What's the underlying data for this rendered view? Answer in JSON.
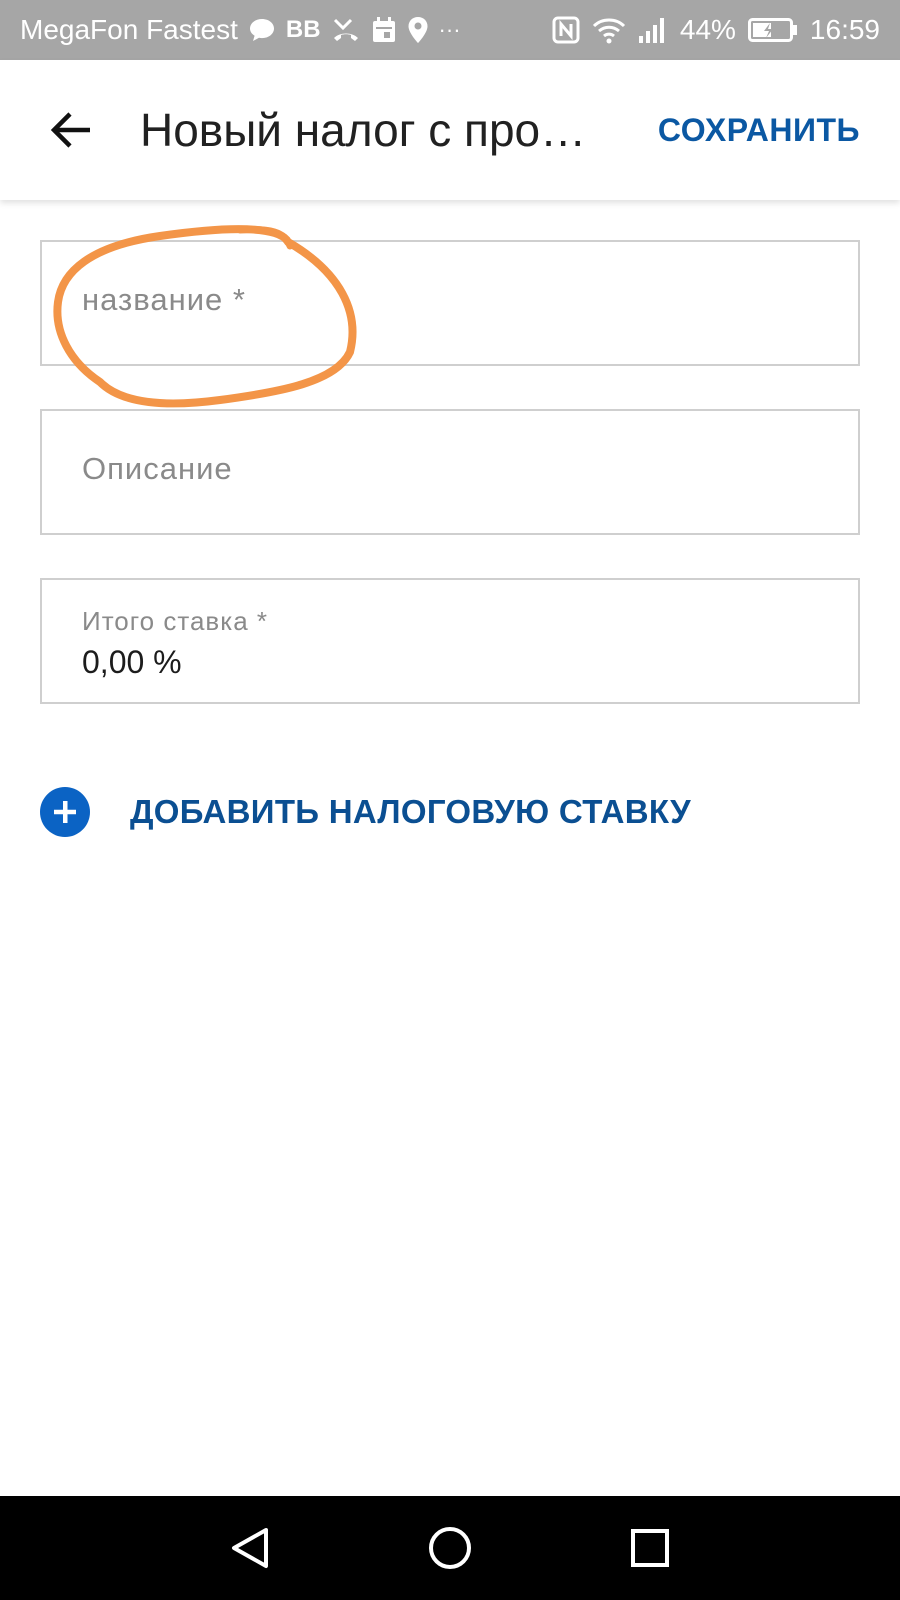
{
  "status_bar": {
    "carrier": "MegaFon Fastest",
    "extra_label": "BB",
    "more": "···",
    "battery": "44%",
    "time": "16:59",
    "icons": [
      "chat-bubble-icon",
      "missed-call-icon",
      "calendar-icon",
      "location-pin-icon",
      "nfc-icon",
      "wifi-icon",
      "signal-icon",
      "battery-icon"
    ]
  },
  "app_bar": {
    "back_icon": "arrow-left-icon",
    "title": "Новый налог с про…",
    "save_label": "СОХРАНИТЬ"
  },
  "form": {
    "name": {
      "placeholder": "название *"
    },
    "description": {
      "placeholder": "Описание"
    },
    "total_rate": {
      "label": "Итого ставка *",
      "value": "0,00 %"
    }
  },
  "add_rate": {
    "icon": "plus-circle-icon",
    "label": "ДОБАВИТЬ НАЛОГОВУЮ СТАВКУ"
  },
  "nav_bar": {
    "icons": [
      "nav-back-triangle-icon",
      "nav-home-circle-icon",
      "nav-recent-square-icon"
    ]
  },
  "colors": {
    "accent": "#0b58a3",
    "plus_button": "#0b63c4",
    "annotation": "#f39548",
    "status_bar": "#a6a6a6",
    "field_border": "#cfcfcf"
  }
}
